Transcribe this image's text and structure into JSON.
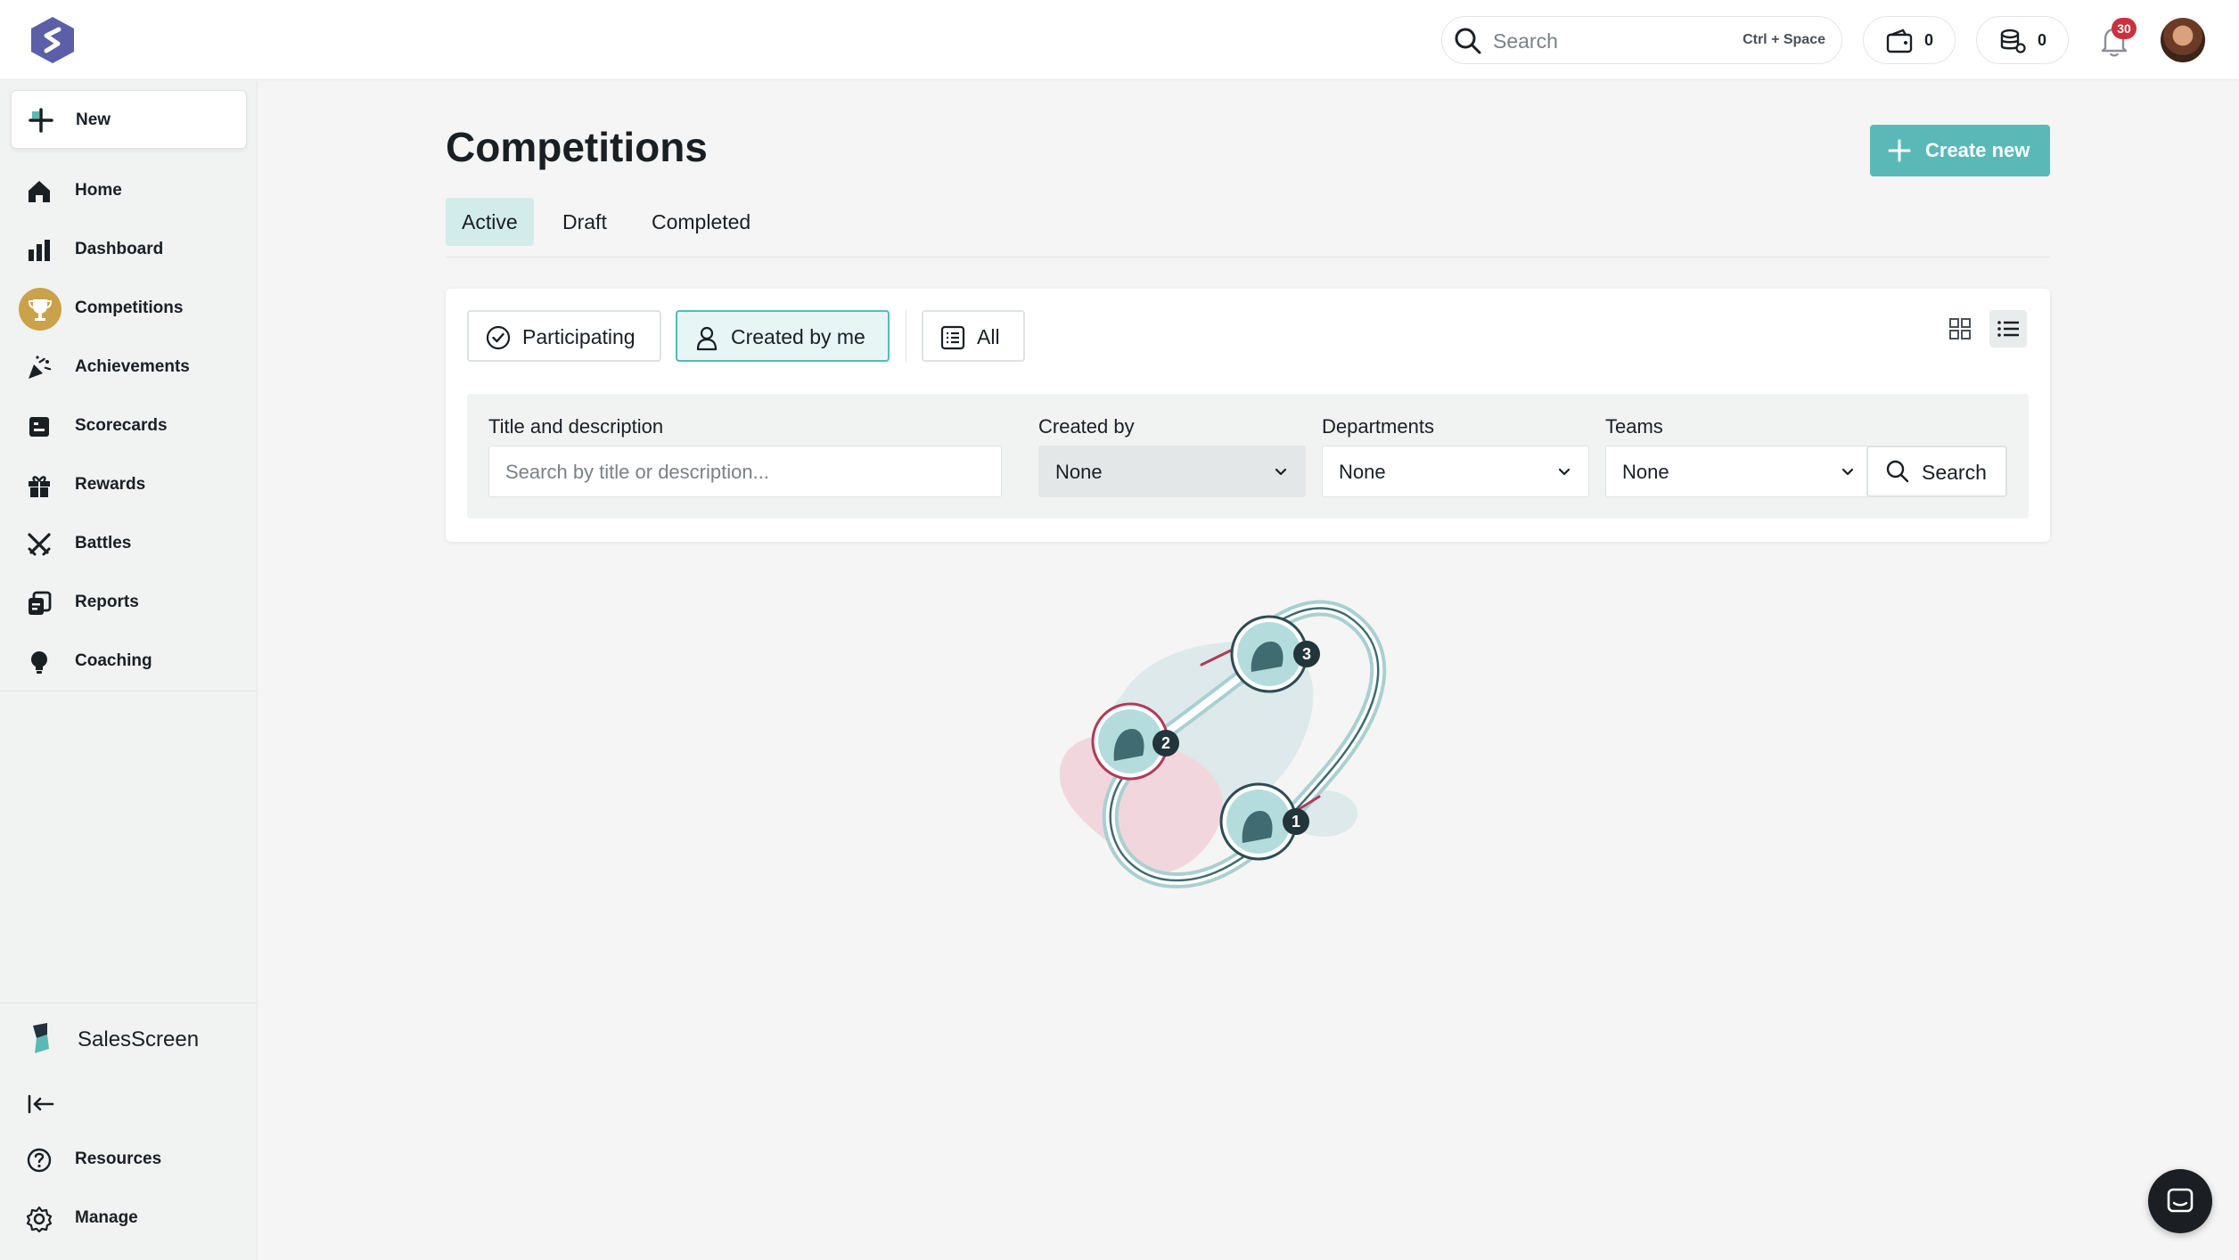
{
  "topbar": {
    "search_placeholder": "Search",
    "search_shortcut": "Ctrl + Space",
    "wallet_count": "0",
    "coins_count": "0",
    "notification_count": "30"
  },
  "sidebar": {
    "new_label": "New",
    "items": [
      {
        "label": "Home",
        "icon": "home-icon"
      },
      {
        "label": "Dashboard",
        "icon": "bar-chart-icon"
      },
      {
        "label": "Competitions",
        "icon": "trophy-icon",
        "active": true
      },
      {
        "label": "Achievements",
        "icon": "party-popper-icon"
      },
      {
        "label": "Scorecards",
        "icon": "scorecard-icon"
      },
      {
        "label": "Rewards",
        "icon": "gift-icon"
      },
      {
        "label": "Battles",
        "icon": "crossed-swords-icon"
      },
      {
        "label": "Reports",
        "icon": "reports-icon"
      },
      {
        "label": "Coaching",
        "icon": "lightbulb-icon"
      }
    ],
    "brand": "SalesScreen",
    "bottom_items": [
      {
        "label": "Resources",
        "icon": "help-circle-icon"
      },
      {
        "label": "Manage",
        "icon": "gear-icon"
      }
    ]
  },
  "page": {
    "title": "Competitions",
    "create_label": "Create new",
    "tabs": [
      {
        "label": "Active",
        "active": true
      },
      {
        "label": "Draft"
      },
      {
        "label": "Completed"
      }
    ]
  },
  "filters": {
    "participating": "Participating",
    "created_by_me": "Created by me",
    "all": "All",
    "title_label": "Title and description",
    "title_placeholder": "Search by title or description...",
    "created_by_label": "Created by",
    "created_by_value": "None",
    "departments_label": "Departments",
    "departments_value": "None",
    "teams_label": "Teams",
    "teams_value": "None",
    "search_label": "Search"
  },
  "illustration": {
    "ranks": [
      "3",
      "2",
      "1"
    ]
  },
  "colors": {
    "accent": "#5ab9b6",
    "accent_light": "#d2ecec",
    "active_nav": "#c9a24a",
    "badge": "#c9323c",
    "brand": "#5b5fa8"
  }
}
